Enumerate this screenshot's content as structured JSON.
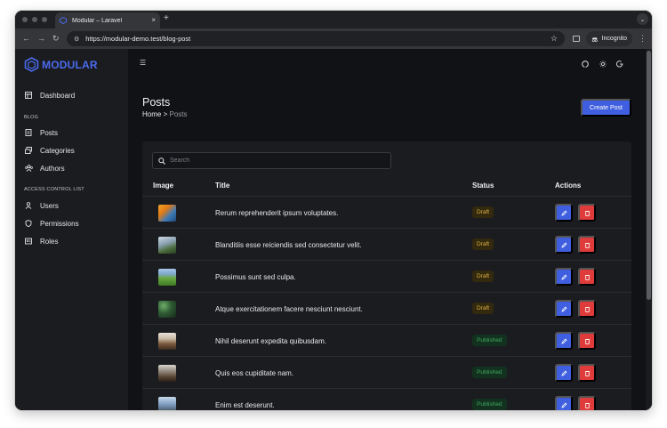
{
  "browser": {
    "tab_title": "Modular – Laravel",
    "url": "https://modular-demo.test/blog-post",
    "incognito_label": "Incognito"
  },
  "sidebar": {
    "logo_text": "MODULAR",
    "dashboard_label": "Dashboard",
    "blog_section": "BLOG",
    "posts_label": "Posts",
    "categories_label": "Categories",
    "authors_label": "Authors",
    "acl_section": "ACCESS CONTROL LIST",
    "users_label": "Users",
    "permissions_label": "Permissions",
    "roles_label": "Roles"
  },
  "header": {
    "title": "Posts",
    "breadcrumb_home": "Home",
    "breadcrumb_sep": ">",
    "breadcrumb_current": "Posts",
    "create_label": "Create Post"
  },
  "search": {
    "placeholder": "Search"
  },
  "table": {
    "columns": [
      "Image",
      "Title",
      "Status",
      "Actions"
    ],
    "rows": [
      {
        "title": "Rerum reprehenderit ipsum voluptates.",
        "status": "Draft"
      },
      {
        "title": "Blanditiis esse reiciendis sed consectetur velit.",
        "status": "Draft"
      },
      {
        "title": "Possimus sunt sed culpa.",
        "status": "Draft"
      },
      {
        "title": "Atque exercitationem facere nesciunt nesciunt.",
        "status": "Draft"
      },
      {
        "title": "Nihil deserunt expedita quibusdam.",
        "status": "Published"
      },
      {
        "title": "Quis eos cupiditate nam.",
        "status": "Published"
      },
      {
        "title": "Enim est deserunt.",
        "status": "Published"
      }
    ]
  },
  "colors": {
    "accent": "#3f5fe0",
    "danger": "#e03b3b",
    "draft": "#e3b341",
    "published": "#3ea860"
  }
}
